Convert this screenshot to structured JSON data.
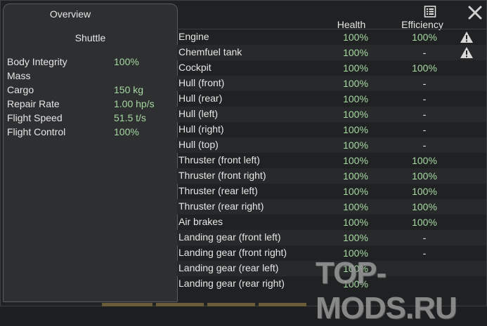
{
  "overview": {
    "tab_label": "Overview",
    "vehicle_name": "Shuttle",
    "stats": [
      {
        "label": "Body Integrity",
        "value": "100%"
      },
      {
        "label": "Mass",
        "value": ""
      },
      {
        "label": "Cargo",
        "value": "150 kg"
      },
      {
        "label": "Repair Rate",
        "value": "1.00 hp/s"
      },
      {
        "label": "Flight Speed",
        "value": "51.5 t/s"
      },
      {
        "label": "Flight Control",
        "value": "100%"
      }
    ]
  },
  "table": {
    "headers": {
      "health": "Health",
      "efficiency": "Efficiency"
    },
    "rows": [
      {
        "name": "Engine",
        "health": "100%",
        "efficiency": "100%",
        "warning": true
      },
      {
        "name": "Chemfuel tank",
        "health": "100%",
        "efficiency": "-",
        "warning": true
      },
      {
        "name": "Cockpit",
        "health": "100%",
        "efficiency": "100%",
        "warning": false
      },
      {
        "name": "Hull (front)",
        "health": "100%",
        "efficiency": "-",
        "warning": false
      },
      {
        "name": "Hull (rear)",
        "health": "100%",
        "efficiency": "-",
        "warning": false
      },
      {
        "name": "Hull (left)",
        "health": "100%",
        "efficiency": "-",
        "warning": false
      },
      {
        "name": "Hull (right)",
        "health": "100%",
        "efficiency": "-",
        "warning": false
      },
      {
        "name": "Hull (top)",
        "health": "100%",
        "efficiency": "-",
        "warning": false
      },
      {
        "name": "Thruster (front left)",
        "health": "100%",
        "efficiency": "100%",
        "warning": false
      },
      {
        "name": "Thruster (front right)",
        "health": "100%",
        "efficiency": "100%",
        "warning": false
      },
      {
        "name": "Thruster (rear left)",
        "health": "100%",
        "efficiency": "100%",
        "warning": false
      },
      {
        "name": "Thruster (rear right)",
        "health": "100%",
        "efficiency": "100%",
        "warning": false
      },
      {
        "name": "Air brakes",
        "health": "100%",
        "efficiency": "100%",
        "warning": false
      },
      {
        "name": "Landing gear (front left)",
        "health": "100%",
        "efficiency": "-",
        "warning": false
      },
      {
        "name": "Landing gear (front right)",
        "health": "100%",
        "efficiency": "-",
        "warning": false
      },
      {
        "name": "Landing gear (rear left)",
        "health": "100%",
        "efficiency": "",
        "warning": false
      },
      {
        "name": "Landing gear (rear right)",
        "health": "100%",
        "efficiency": "",
        "warning": false
      }
    ]
  },
  "icons": {
    "close": "close-icon",
    "info": "document-list-icon",
    "warning": "warning-icon"
  },
  "watermark": "TOP-MODS.RU",
  "colors": {
    "value_green": "#a7d9a2",
    "panel_bg": "#2d2f31",
    "window_bg": "#1f2123"
  }
}
